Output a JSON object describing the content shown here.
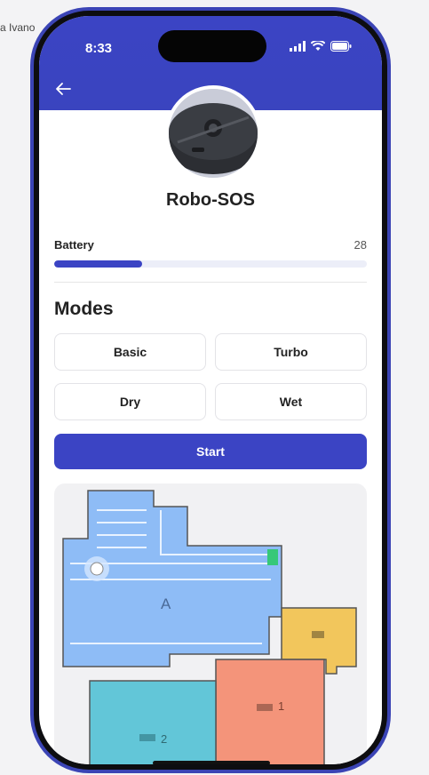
{
  "background": {
    "label": "a Ivano"
  },
  "status_bar": {
    "time": "8:33"
  },
  "header": {
    "back_icon": "arrow-left-icon"
  },
  "device": {
    "name": "Robo-SOS"
  },
  "battery": {
    "label": "Battery",
    "value": "28",
    "level_percent": 28
  },
  "modes": {
    "title": "Modes",
    "items": [
      {
        "label": "Basic"
      },
      {
        "label": "Turbo"
      },
      {
        "label": "Dry"
      },
      {
        "label": "Wet"
      }
    ]
  },
  "start_button": {
    "label": "Start"
  },
  "map": {
    "rooms": [
      {
        "label": "A",
        "color": "#8ebcf6"
      },
      {
        "label": "1",
        "color": "#f4947a"
      },
      {
        "label": "2",
        "color": "#62c6d8"
      },
      {
        "label": "",
        "color": "#f2c65c"
      }
    ]
  },
  "colors": {
    "accent": "#3b44c4",
    "frame": "#3b44b5"
  }
}
